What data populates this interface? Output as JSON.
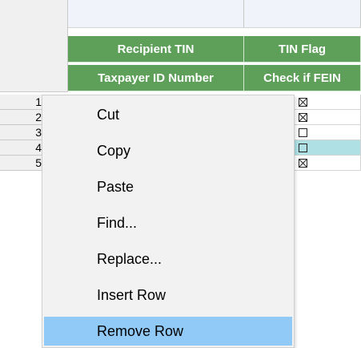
{
  "columns": [
    {
      "header": "Recipient TIN",
      "subheader": "Taxpayer ID Number"
    },
    {
      "header": "TIN Flag",
      "subheader": "Check if FEIN"
    }
  ],
  "rows": [
    {
      "number": "1",
      "tin_flag_checked": true
    },
    {
      "number": "2",
      "tin_flag_checked": true
    },
    {
      "number": "3",
      "tin_flag_checked": false
    },
    {
      "number": "4",
      "tin_flag_checked": false,
      "selected": true
    },
    {
      "number": "5",
      "tin_flag_checked": true
    }
  ],
  "context_menu": {
    "items": [
      "Cut",
      "Copy",
      "Paste",
      "Find...",
      "Replace...",
      "Insert Row",
      "Remove Row"
    ],
    "highlighted": "Remove Row"
  },
  "colors": {
    "header_green": "#5ea05a",
    "selected_cell": "#aee0e4",
    "menu_highlight": "#91c9f7"
  }
}
